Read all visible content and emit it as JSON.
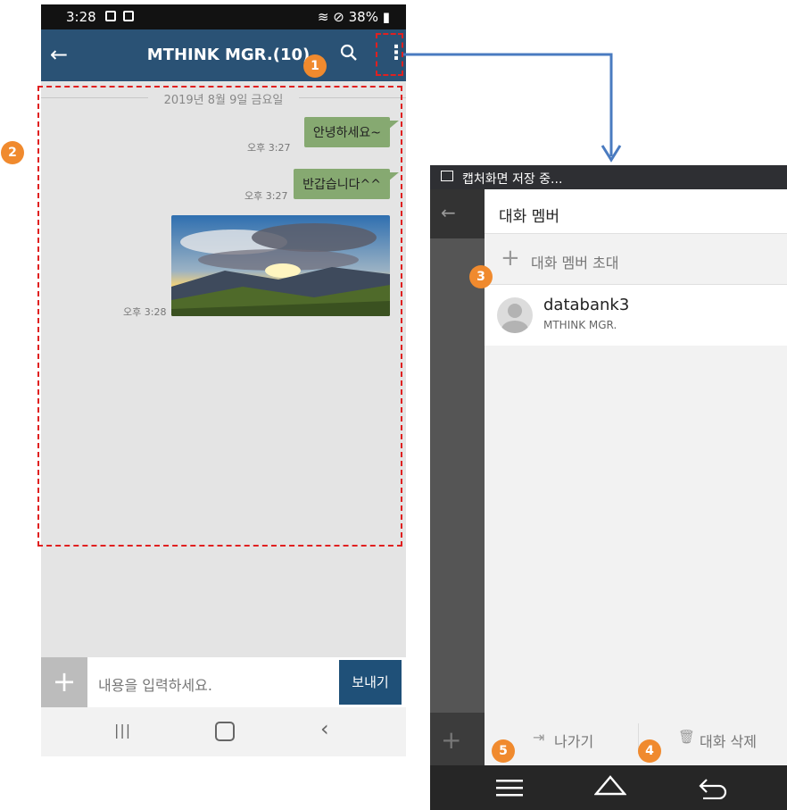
{
  "left": {
    "status": {
      "time": "3:28",
      "battery": "38%"
    },
    "appbar": {
      "title": "MTHINK MGR.(10)",
      "back_icon": "←",
      "search_icon": "🔍",
      "more_icon": "⋮"
    },
    "date": "2019년 8월 9일 금요일",
    "messages": [
      {
        "text": "안녕하세요~",
        "time": "오후 3:27"
      },
      {
        "text": "반갑습니다^^",
        "time": "오후 3:27"
      },
      {
        "type": "image",
        "time": "오후 3:28"
      }
    ],
    "input": {
      "plus": "+",
      "placeholder": "내용을 입력하세요.",
      "send": "보내기"
    },
    "nav": {
      "recent": "|||",
      "home": "○",
      "back": "‹"
    }
  },
  "right": {
    "status": "캡처화면 저장 중...",
    "header_title": "대화 멤버",
    "invite": "대화 멤버 초대",
    "member": {
      "name": "databank3",
      "sub": "MTHINK MGR."
    },
    "leave": "나가기",
    "delete": "대화 삭제"
  },
  "markers": [
    "1",
    "2",
    "3",
    "4",
    "5"
  ],
  "colors": {
    "appbar": "#2a5275",
    "bubble": "#86a971",
    "marker": "#f08a2e",
    "arrow": "#4a7bc0",
    "highlight": "#e02020"
  }
}
